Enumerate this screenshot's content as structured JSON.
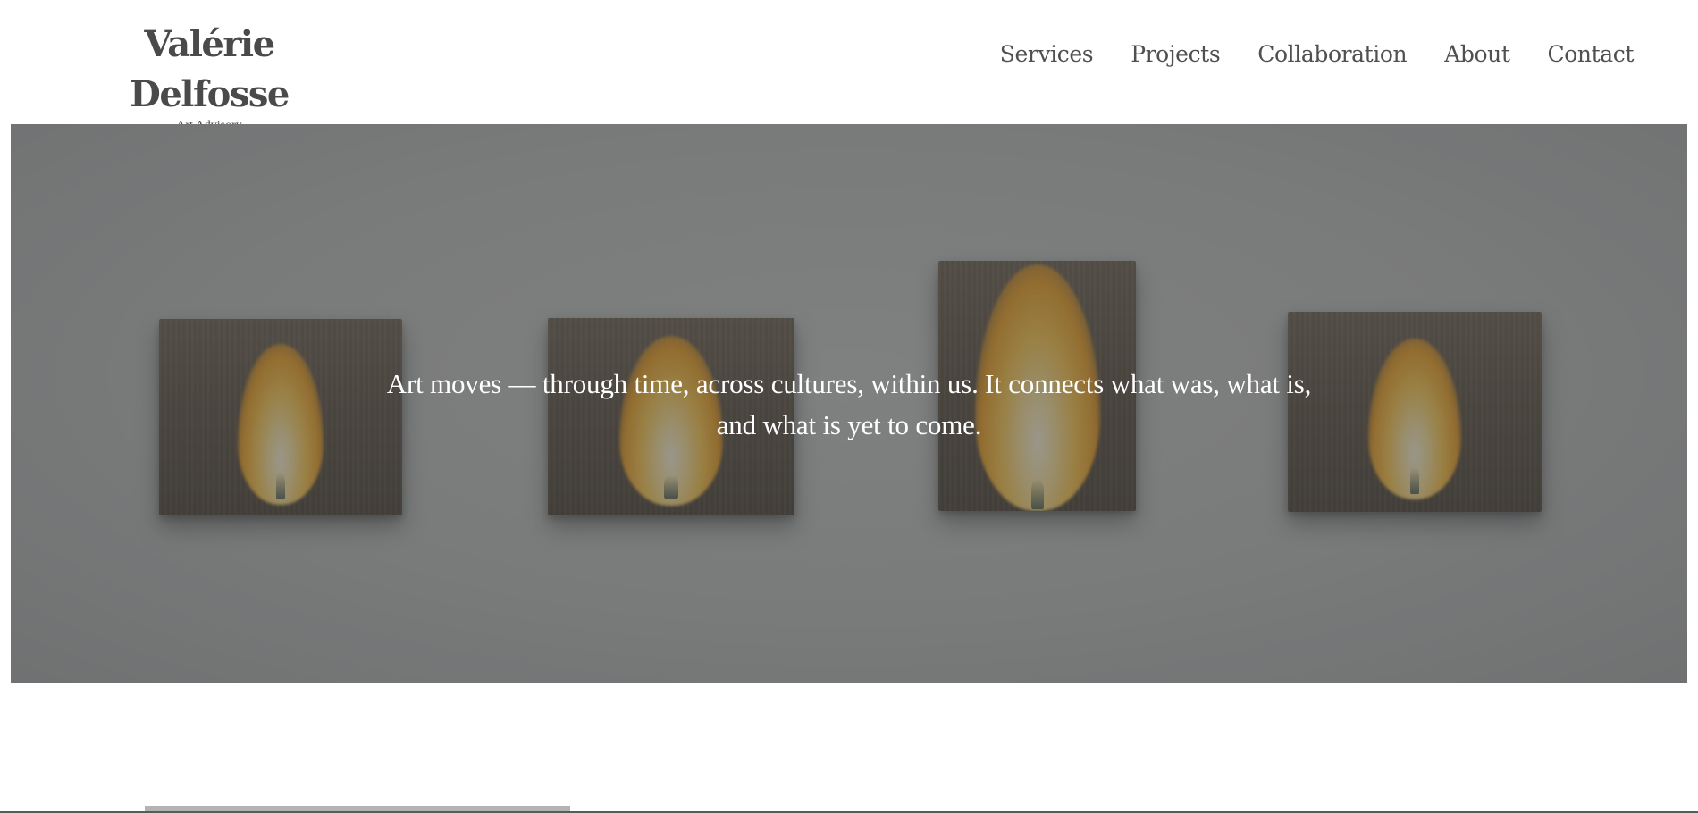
{
  "brand": {
    "name": "Valérie Delfosse",
    "tagline": "Art Advisory"
  },
  "nav": {
    "items": [
      {
        "label": "Services"
      },
      {
        "label": "Projects"
      },
      {
        "label": "Collaboration"
      },
      {
        "label": "About"
      },
      {
        "label": "Contact"
      }
    ]
  },
  "hero": {
    "quote_line1": "Art moves — through time, across cultures, within us. It connects what was, what is,",
    "quote_line2": "and what is yet to come."
  },
  "colors": {
    "text_dark": "#4a4a4a",
    "nav_text": "#505050",
    "hero_text": "#ffffff"
  }
}
